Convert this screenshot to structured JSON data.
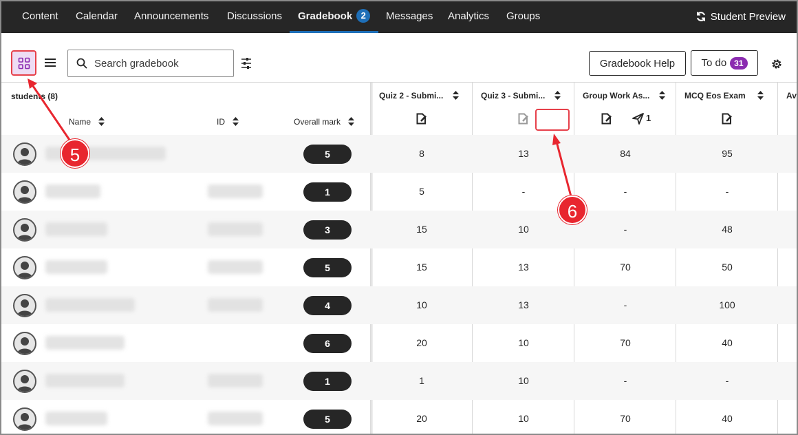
{
  "nav": {
    "tabs": [
      {
        "label": "Content"
      },
      {
        "label": "Calendar"
      },
      {
        "label": "Announcements"
      },
      {
        "label": "Discussions"
      },
      {
        "label": "Gradebook",
        "badge": "2"
      },
      {
        "label": "Messages"
      },
      {
        "label": "Analytics"
      },
      {
        "label": "Groups"
      }
    ],
    "active": "Gradebook",
    "student_preview": "Student Preview",
    "preview_icon": "refresh-icon"
  },
  "toolbar": {
    "grid_view_icon": "grid-icon",
    "list_view_icon": "list-icon",
    "search_placeholder": "Search gradebook",
    "filter_icon": "sliders-icon",
    "help_label": "Gradebook Help",
    "todo_label": "To do",
    "todo_count": "31",
    "settings_icon": "gear-icon"
  },
  "table": {
    "students_label": "students (8)",
    "col_name": "Name",
    "col_id": "ID",
    "col_overall": "Overall mark",
    "items": [
      {
        "title": "Quiz 2 - Submi...",
        "icon": "assignment-icon"
      },
      {
        "title": "Quiz 3 - Submi...",
        "icon": "assignment-icon-faded"
      },
      {
        "title": "Group Work As...",
        "icon": "assignment-icon",
        "extra_icon": "send-icon",
        "extra_count": "1"
      },
      {
        "title": "MCQ Eos Exam",
        "icon": "assignment-icon"
      },
      {
        "title": "Ave"
      }
    ],
    "rows": [
      {
        "overall": "5",
        "grades": [
          "8",
          "13",
          "84",
          "95"
        ]
      },
      {
        "overall": "1",
        "grades": [
          "5",
          "-",
          "-",
          "-"
        ]
      },
      {
        "overall": "3",
        "grades": [
          "15",
          "10",
          "-",
          "48"
        ]
      },
      {
        "overall": "5",
        "grades": [
          "15",
          "13",
          "70",
          "50"
        ]
      },
      {
        "overall": "4",
        "grades": [
          "10",
          "13",
          "-",
          "100"
        ]
      },
      {
        "overall": "6",
        "grades": [
          "20",
          "10",
          "70",
          "40"
        ]
      },
      {
        "overall": "1",
        "grades": [
          "1",
          "10",
          "-",
          "-"
        ]
      },
      {
        "overall": "5",
        "grades": [
          "20",
          "10",
          "70",
          "40"
        ]
      }
    ]
  },
  "annotations": {
    "callout_5": "5",
    "callout_6": "6",
    "accent": "#e8262f"
  },
  "colors": {
    "nav_bg": "#262626",
    "nav_active": "#1e6fb8",
    "todo_badge": "#8b2bb0",
    "grid_active_bg": "#eedcf4"
  }
}
